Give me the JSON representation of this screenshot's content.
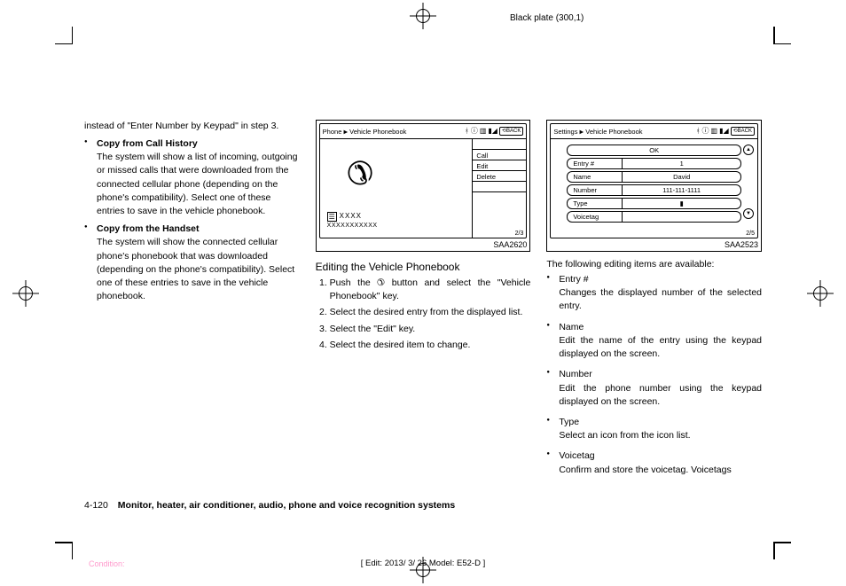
{
  "header_plate": "Black plate (300,1)",
  "footer_edit": "[ Edit: 2013/ 3/ 26   Model: E52-D ]",
  "footer_condition": "Condition:",
  "col1": {
    "lead": "instead of \"Enter Number by Keypad\" in step 3.",
    "items": [
      {
        "title": "Copy from Call History",
        "desc": "The system will show a list of incoming, outgoing or missed calls that were downloaded from the connected cellular phone (depending on the phone's compatibility). Select one of these entries to save in the vehicle phonebook."
      },
      {
        "title": "Copy from the Handset",
        "desc": "The system will show the connected cellular phone's phonebook that was downloaded (depending on the phone's compatibility). Select one of these entries to save in the vehicle phonebook."
      }
    ]
  },
  "fig1": {
    "breadcrumb_a": "Phone",
    "breadcrumb_b": "Vehicle Phonebook",
    "back": "BACK",
    "xxxx": "XXXX",
    "xxxx2": "XXXXXXXXXXX",
    "menu": [
      "",
      "Call",
      "Edit",
      "Delete",
      "",
      ""
    ],
    "counter": "2/3",
    "id": "SAA2620"
  },
  "col2": {
    "heading": "Editing the Vehicle Phonebook",
    "steps": [
      {
        "pre": "Push the ",
        "post": " button and select the \"Vehicle Phonebook\" key."
      },
      {
        "text": "Select the desired entry from the displayed list."
      },
      {
        "text": "Select the \"Edit\" key."
      },
      {
        "text": "Select the desired item to change."
      }
    ]
  },
  "fig2": {
    "breadcrumb_a": "Settings",
    "breadcrumb_b": "Vehicle Phonebook",
    "back": "BACK",
    "ok": "OK",
    "rows": [
      {
        "label": "Entry #",
        "value": "1"
      },
      {
        "label": "Name",
        "value": "David"
      },
      {
        "label": "Number",
        "value": "111-111-1111"
      },
      {
        "label": "Type",
        "value": "▮"
      },
      {
        "label": "Voicetag",
        "value": ""
      }
    ],
    "counter": "2/5",
    "id": "SAA2523"
  },
  "col3": {
    "intro": "The following editing items are available:",
    "items": [
      {
        "name": "Entry #",
        "desc": "Changes the displayed number of the selected entry."
      },
      {
        "name": "Name",
        "desc": "Edit the name of the entry using the keypad displayed on the screen."
      },
      {
        "name": "Number",
        "desc": "Edit the phone number using the keypad displayed on the screen."
      },
      {
        "name": "Type",
        "desc": "Select an icon from the icon list."
      },
      {
        "name": "Voicetag",
        "desc": "Confirm and store the voicetag. Voicetags"
      }
    ]
  },
  "footer": {
    "page": "4-120",
    "chapter": "Monitor, heater, air conditioner, audio, phone and voice recognition systems"
  }
}
